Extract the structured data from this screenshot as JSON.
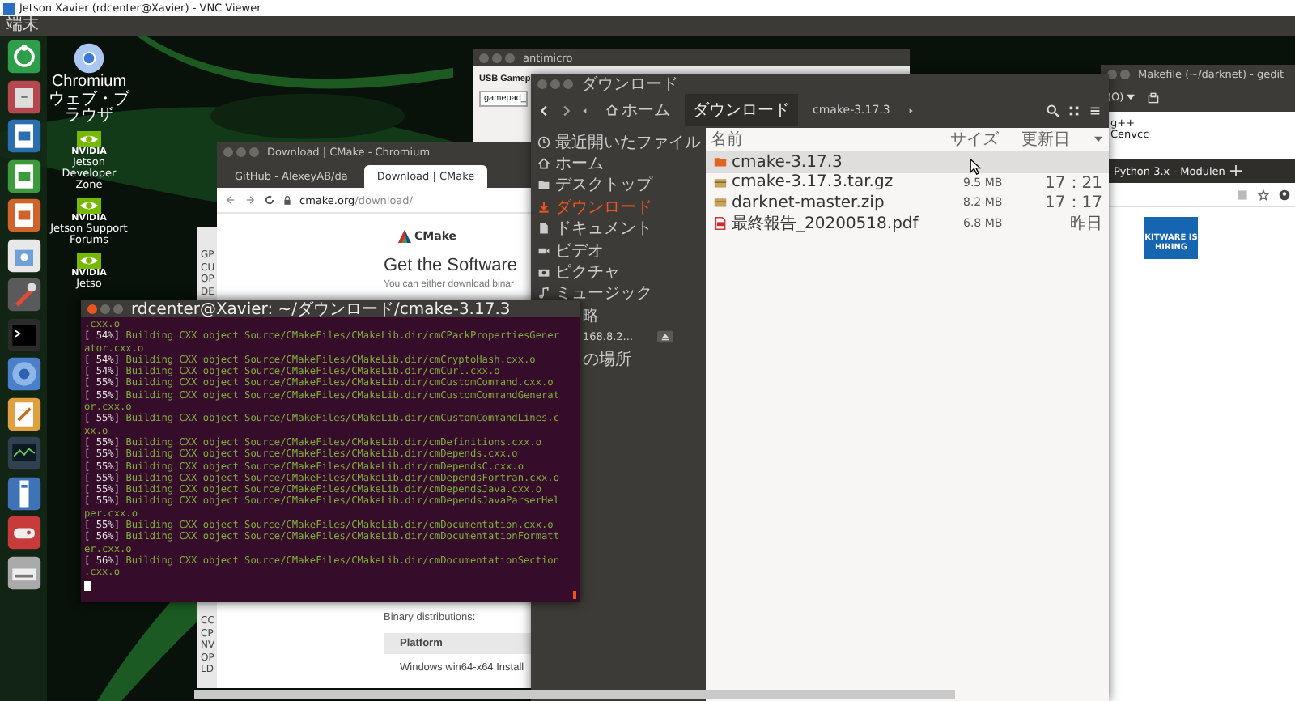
{
  "vnc_window": {
    "title": "Jetson Xavier (rdcenter@Xavier) - VNC Viewer"
  },
  "top_bar": {
    "app_name": "端末"
  },
  "desktop_icons": [
    {
      "kind": "chromium",
      "label": "Chromium ウェブ・ブラウザ"
    },
    {
      "kind": "nvidia",
      "brand": "NVIDIA",
      "label": "Jetson Developer Zone"
    },
    {
      "kind": "nvidia",
      "brand": "NVIDIA",
      "label": "Jetson Support Forums"
    },
    {
      "kind": "nvidia",
      "brand": "NVIDIA",
      "label": "Jetso"
    }
  ],
  "antimicro": {
    "title": "antimicro",
    "label": "USB Gamep",
    "field_value": "gamepad_"
  },
  "gedit": {
    "title": "Makefile (~/darknet) - gedit",
    "open_menu": "(O)",
    "lines": [
      "g++",
      "Cenvcc"
    ]
  },
  "browser_right": {
    "tab": "Python 3.x - Modulen",
    "banner": "KITWARE IS HIRING"
  },
  "back_window": {
    "top_letters": [
      "GP",
      "CU",
      "OP",
      "DE"
    ],
    "bottom_letters": [
      "CC",
      "CP",
      "NV",
      "OP",
      "LD"
    ]
  },
  "chromium": {
    "title": "Download | CMake - Chromium",
    "tabs": [
      {
        "label": "GitHub - AlexeyAB/da",
        "selected": false
      },
      {
        "label": "Download | CMake",
        "selected": true
      }
    ],
    "url_host": "cmake.org",
    "url_path": "/download/",
    "logo_text": "CMake",
    "heading": "Get the Software",
    "intro": "You can either download binar",
    "section": "Binary distributions:",
    "table_header": "Platform",
    "table_row": "Windows win64-x64 Install"
  },
  "file_manager": {
    "title": "ダウンロード",
    "path": [
      {
        "kind": "home",
        "label": "ホーム",
        "selected": false
      },
      {
        "kind": "folder",
        "label": "ダウンロード",
        "selected": true
      },
      {
        "kind": "folder",
        "label": "cmake-3.17.3",
        "selected": false
      }
    ],
    "sidebar": [
      {
        "kind": "recent",
        "label": "最近開いたファイル",
        "selected": false
      },
      {
        "kind": "home",
        "label": "ホーム",
        "selected": false
      },
      {
        "kind": "folder",
        "label": "デスクトップ",
        "selected": false
      },
      {
        "kind": "download",
        "label": "ダウンロード",
        "selected": true
      },
      {
        "kind": "document",
        "label": "ドキュメント",
        "selected": false
      },
      {
        "kind": "video",
        "label": "ビデオ",
        "selected": false
      },
      {
        "kind": "picture",
        "label": "ピクチャ",
        "selected": false
      },
      {
        "kind": "music",
        "label": "ミュージック",
        "selected": false
      },
      {
        "kind": "plain",
        "label": "略",
        "selected": false
      },
      {
        "kind": "network",
        "label": "168.8.2...",
        "selected": false
      },
      {
        "kind": "plain",
        "label": "の場所",
        "selected": false
      }
    ],
    "columns": [
      "名前",
      "サイズ",
      "更新日"
    ],
    "files": [
      {
        "kind": "folder",
        "name": "cmake-3.17.3",
        "selected": true
      },
      {
        "kind": "archive",
        "name": "cmake-3.17.3.tar.gz",
        "size": "9.5 MB",
        "date": "17：21",
        "selected": false
      },
      {
        "kind": "archive",
        "name": "darknet-master.zip",
        "size": "8.2 MB",
        "date": "17：17",
        "selected": false
      },
      {
        "kind": "pdf",
        "name": "最終報告_20200518.pdf",
        "size": "6.8 MB",
        "date": "昨日",
        "selected": false
      }
    ]
  },
  "terminal": {
    "title": "rdcenter@Xavier: ~/ダウンロード/cmake-3.17.3",
    "lines": [
      {
        "kind": "wrap",
        "text": ".cxx.o"
      },
      {
        "kind": "progress",
        "percent": "[ 54%]",
        "text": "Building CXX object Source/CMakeFiles/CMakeLib.dir/cmCPackPropertiesGener"
      },
      {
        "kind": "wrap",
        "text": "ator.cxx.o"
      },
      {
        "kind": "progress",
        "percent": "[ 54%]",
        "text": "Building CXX object Source/CMakeFiles/CMakeLib.dir/cmCryptoHash.cxx.o"
      },
      {
        "kind": "progress",
        "percent": "[ 54%]",
        "text": "Building CXX object Source/CMakeFiles/CMakeLib.dir/cmCurl.cxx.o"
      },
      {
        "kind": "progress",
        "percent": "[ 55%]",
        "text": "Building CXX object Source/CMakeFiles/CMakeLib.dir/cmCustomCommand.cxx.o"
      },
      {
        "kind": "progress",
        "percent": "[ 55%]",
        "text": "Building CXX object Source/CMakeFiles/CMakeLib.dir/cmCustomCommandGenerat"
      },
      {
        "kind": "wrap",
        "text": "or.cxx.o"
      },
      {
        "kind": "progress",
        "percent": "[ 55%]",
        "text": "Building CXX object Source/CMakeFiles/CMakeLib.dir/cmCustomCommandLines.c"
      },
      {
        "kind": "wrap",
        "text": "xx.o"
      },
      {
        "kind": "progress",
        "percent": "[ 55%]",
        "text": "Building CXX object Source/CMakeFiles/CMakeLib.dir/cmDefinitions.cxx.o"
      },
      {
        "kind": "progress",
        "percent": "[ 55%]",
        "text": "Building CXX object Source/CMakeFiles/CMakeLib.dir/cmDepends.cxx.o"
      },
      {
        "kind": "progress",
        "percent": "[ 55%]",
        "text": "Building CXX object Source/CMakeFiles/CMakeLib.dir/cmDependsC.cxx.o"
      },
      {
        "kind": "progress",
        "percent": "[ 55%]",
        "text": "Building CXX object Source/CMakeFiles/CMakeLib.dir/cmDependsFortran.cxx.o"
      },
      {
        "kind": "progress",
        "percent": "[ 55%]",
        "text": "Building CXX object Source/CMakeFiles/CMakeLib.dir/cmDependsJava.cxx.o"
      },
      {
        "kind": "progress",
        "percent": "[ 55%]",
        "text": "Building CXX object Source/CMakeFiles/CMakeLib.dir/cmDependsJavaParserHel"
      },
      {
        "kind": "wrap",
        "text": "per.cxx.o"
      },
      {
        "kind": "progress",
        "percent": "[ 55%]",
        "text": "Building CXX object Source/CMakeFiles/CMakeLib.dir/cmDocumentation.cxx.o"
      },
      {
        "kind": "progress",
        "percent": "[ 56%]",
        "text": "Building CXX object Source/CMakeFiles/CMakeLib.dir/cmDocumentationFormatt"
      },
      {
        "kind": "wrap",
        "text": "er.cxx.o"
      },
      {
        "kind": "progress",
        "percent": "[ 56%]",
        "text": "Building CXX object Source/CMakeFiles/CMakeLib.dir/cmDocumentationSection"
      },
      {
        "kind": "wrap",
        "text": ".cxx.o"
      }
    ]
  }
}
